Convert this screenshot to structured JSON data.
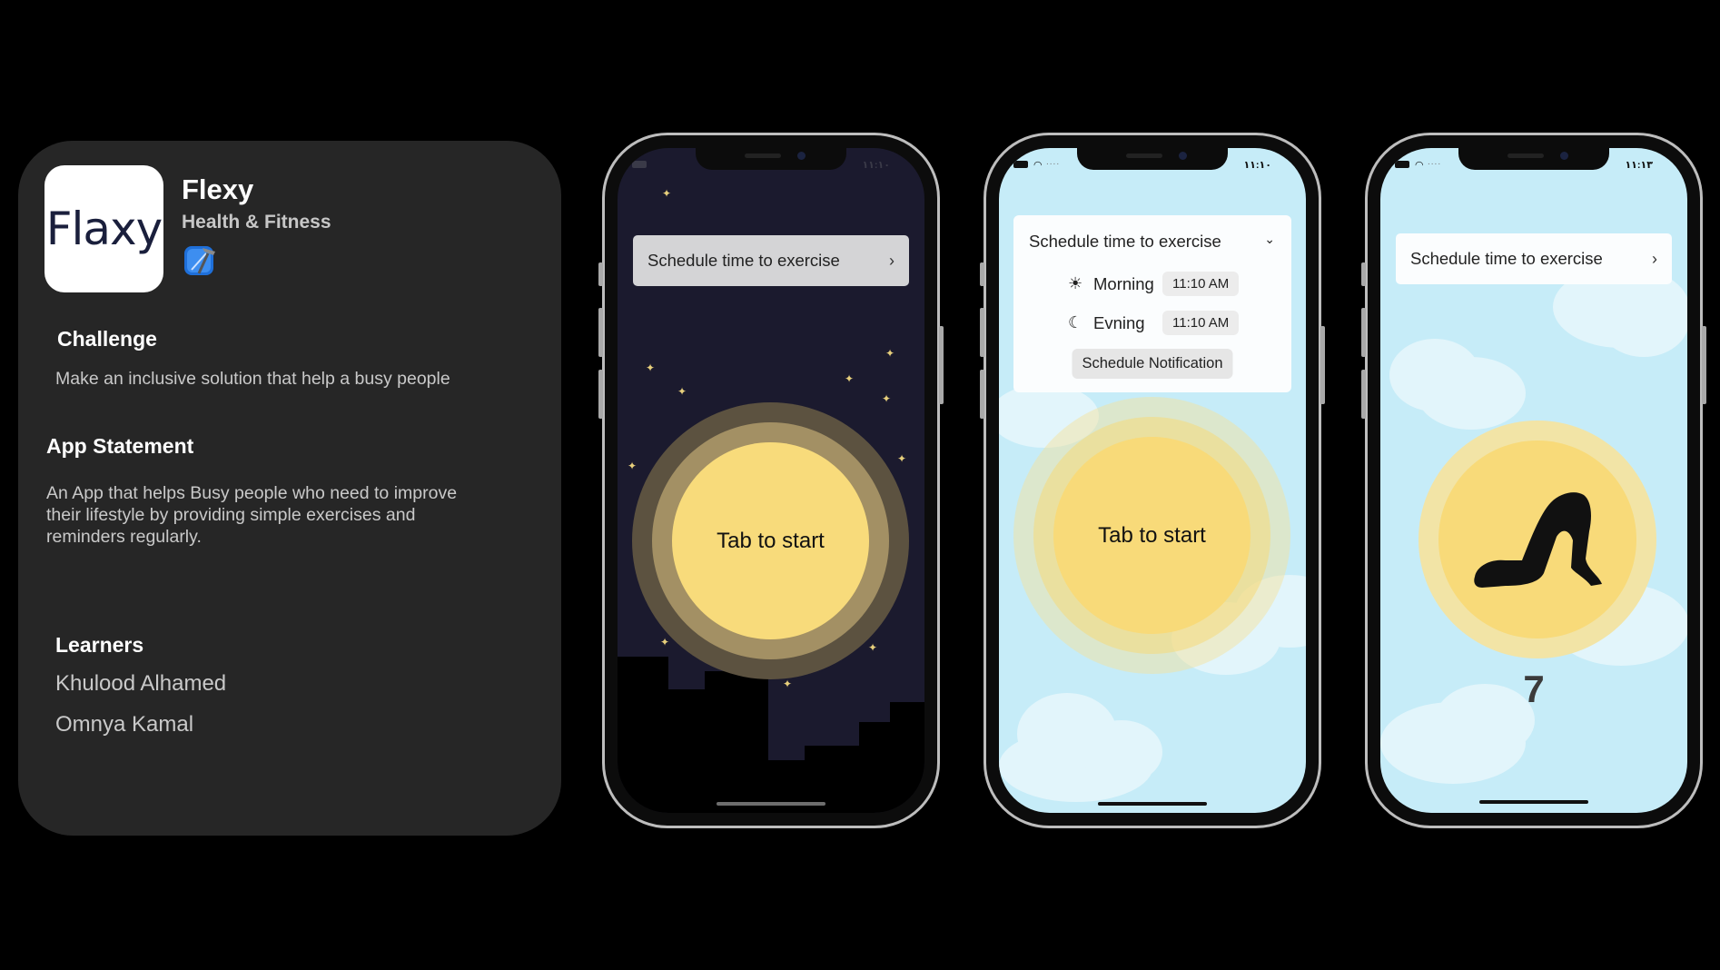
{
  "app": {
    "logo_text": "Flaxy",
    "name": "Flexy",
    "category": "Health & Fitness",
    "tool_icon": "xcode-icon"
  },
  "challenge": {
    "heading": "Challenge",
    "text": "Make an inclusive solution that help a busy people"
  },
  "statement": {
    "heading": "App Statement",
    "text": "An App that helps Busy people who need to improve their lifestyle by providing simple exercises and reminders regularly."
  },
  "learners": {
    "heading": "Learners",
    "names": [
      "Khulood Alhamed",
      "Omnya Kamal"
    ]
  },
  "phones": {
    "p1": {
      "theme": "night",
      "status_time": "١١:١٠",
      "schedule_label": "Schedule time to exercise",
      "chevron": "›",
      "sun_label": "Tab to start"
    },
    "p2": {
      "theme": "day",
      "status_time": "١١:١٠",
      "schedule_label": "Schedule time to exercise",
      "chevron": "⌄",
      "morning_label": "Morning",
      "morning_time": "11:10 AM",
      "evening_label": "Evning",
      "evening_time": "11:10 AM",
      "notify_button": "Schedule Notification",
      "sun_label": "Tab to start"
    },
    "p3": {
      "theme": "day",
      "status_time": "١١:١٣",
      "schedule_label": "Schedule time to exercise",
      "chevron": "›",
      "exercise_icon": "yoga-plow-pose-icon",
      "counter": "7"
    }
  },
  "colors": {
    "background": "#000000",
    "card": "#262626",
    "night_sky": "#1b1a2e",
    "day_sky": "#c6ecf8",
    "sun": "#f8db7b"
  }
}
